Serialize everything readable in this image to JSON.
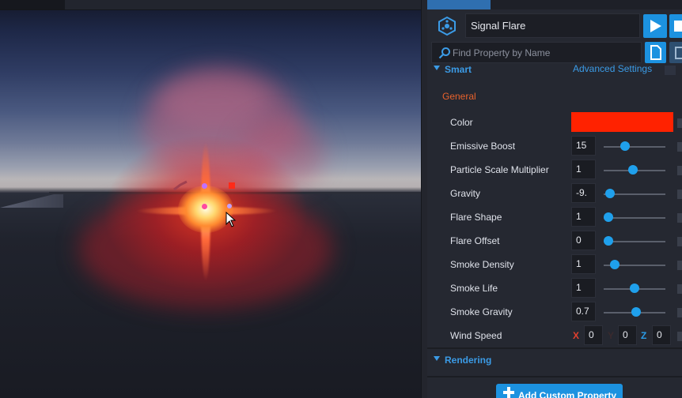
{
  "object": {
    "name": "Signal Flare"
  },
  "search": {
    "placeholder": "Find Property by Name"
  },
  "sections": {
    "smart": "Smart",
    "advanced_settings": "Advanced Settings",
    "general": "General",
    "rendering": "Rendering"
  },
  "properties": {
    "color": {
      "label": "Color",
      "value": "#ff2200"
    },
    "emissive_boost": {
      "label": "Emissive Boost",
      "value": "15",
      "slider": 0.35
    },
    "particle_scale": {
      "label": "Particle Scale Multiplier",
      "value": "1",
      "slider": 0.48
    },
    "gravity": {
      "label": "Gravity",
      "value": "-9.",
      "slider": 0.1
    },
    "flare_shape": {
      "label": "Flare Shape",
      "value": "1",
      "slider": 0.08
    },
    "flare_offset": {
      "label": "Flare Offset",
      "value": "0",
      "slider": 0.08
    },
    "smoke_density": {
      "label": "Smoke Density",
      "value": "1",
      "slider": 0.18
    },
    "smoke_life": {
      "label": "Smoke Life",
      "value": "1",
      "slider": 0.5
    },
    "smoke_gravity": {
      "label": "Smoke Gravity",
      "value": "0.7",
      "slider": 0.52
    },
    "wind_speed": {
      "label": "Wind Speed",
      "x_label": "X",
      "x": "0",
      "y_label": "Y",
      "y": "0",
      "z_label": "Z",
      "z": "0"
    }
  },
  "buttons": {
    "add_custom_property": "Add Custom Property"
  },
  "colors": {
    "accent": "#1c92e0",
    "section_header": "#3b9be6",
    "general_label": "#e8622c",
    "axis_x": "#e0402e",
    "axis_y": "#3a2a2e",
    "axis_z": "#2a9be6"
  },
  "icons": {
    "object_icon": "smart-object-icon",
    "play": "play-icon",
    "stop": "stop-icon",
    "search": "search-icon",
    "doc": "document-icon",
    "plus": "plus-icon"
  }
}
